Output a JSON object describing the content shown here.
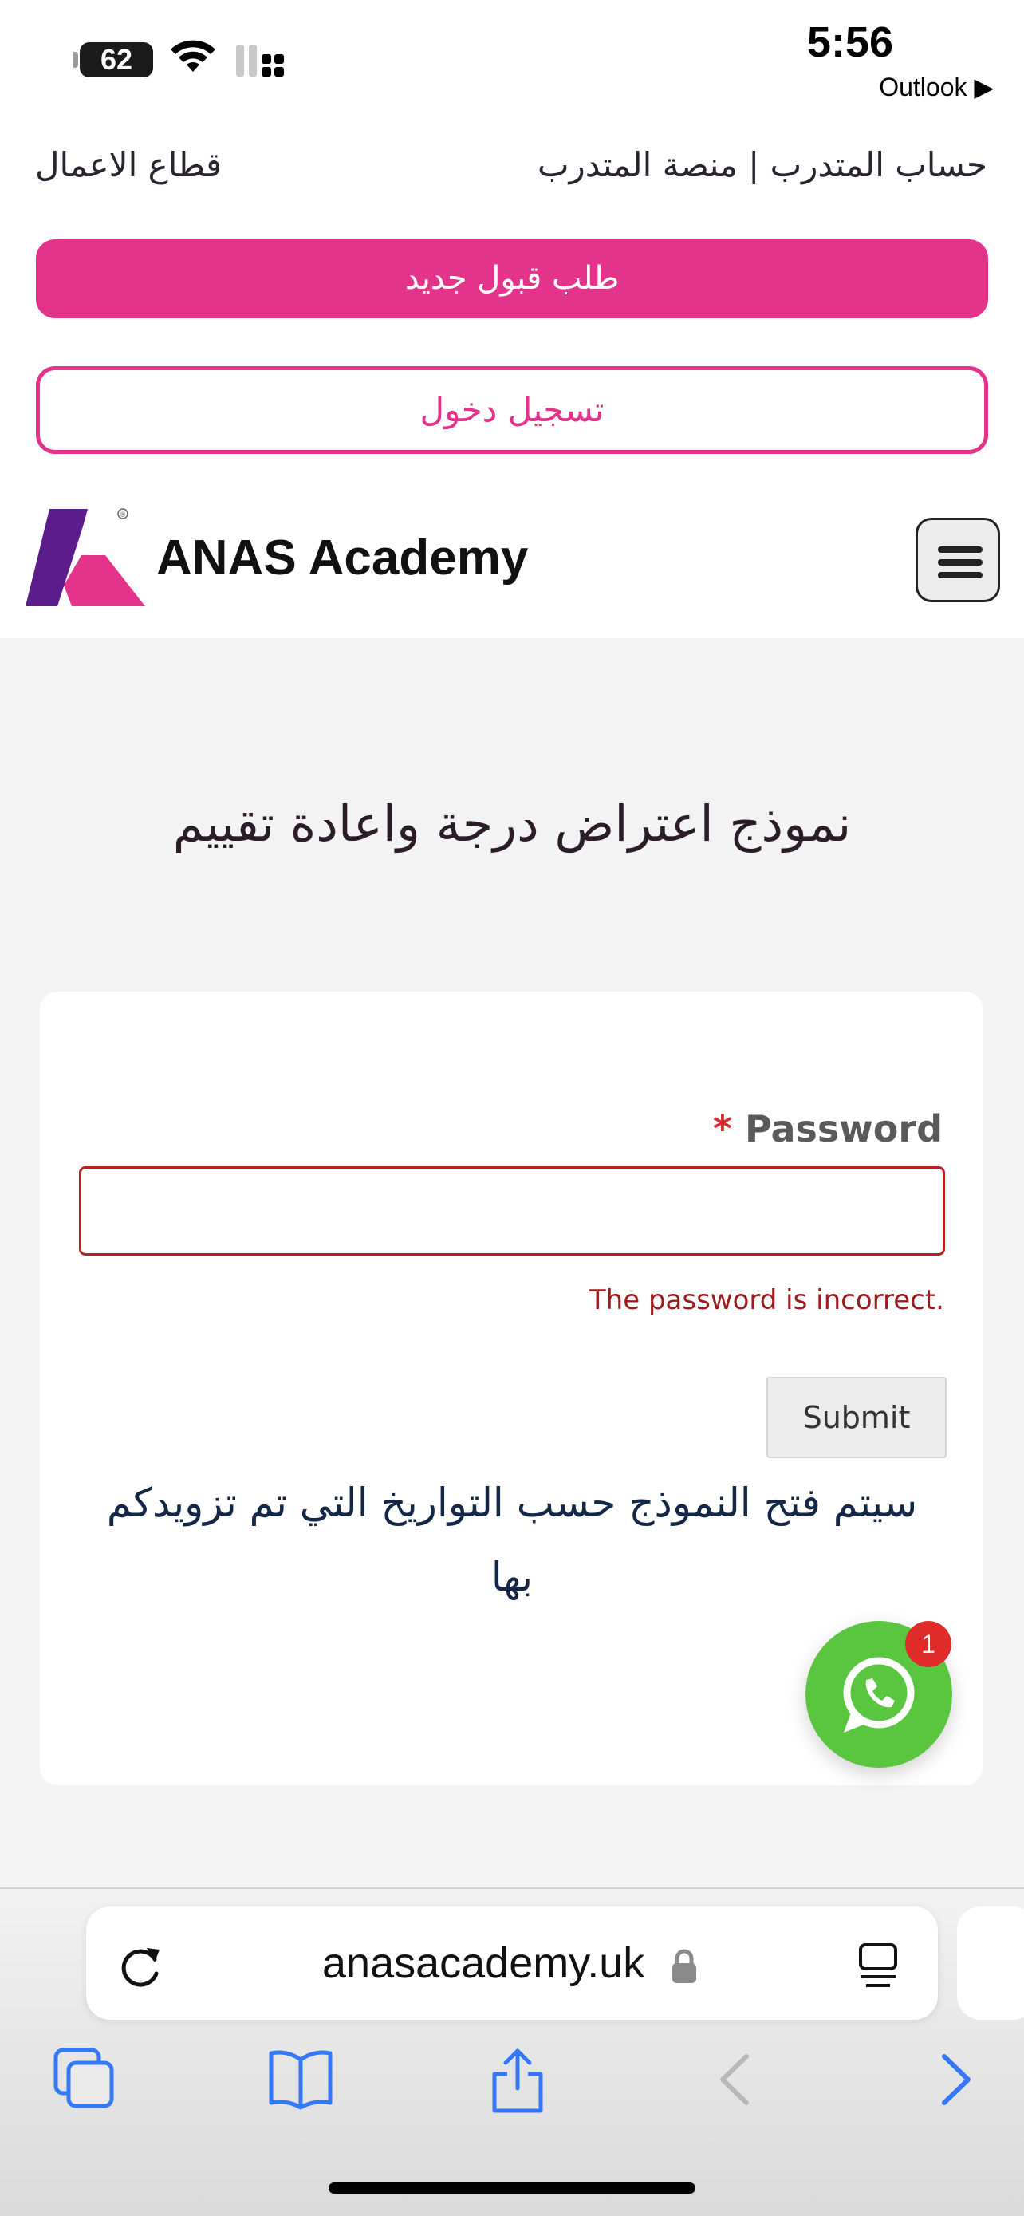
{
  "status": {
    "battery": "62",
    "time": "5:56",
    "back_app": "Outlook ▶"
  },
  "header": {
    "link_right": "حساب المتدرب | منصة المتدرب",
    "link_left": "قطاع الاعمال",
    "primary_button": "طلب قبول جديد",
    "outline_button": "تسجيل دخول",
    "brand": "ANAS Academy",
    "logo_registered": "®"
  },
  "main": {
    "title": "نموذج اعتراض درجة واعادة تقييم",
    "form": {
      "required_mark": "*",
      "password_label": "Password",
      "password_value": "",
      "error": "The password is incorrect.",
      "submit_label": "Submit"
    },
    "notice": "سيتم فتح النموذج حسب التواريخ التي تم تزويدكم بها",
    "whatsapp_badge": "1"
  },
  "browser": {
    "url": "anasacademy.uk",
    "accent_color": "#3478f6"
  },
  "colors": {
    "brand_pink": "#e3338a",
    "brand_purple": "#5b1c8c",
    "error_red": "#9b1c1c",
    "whatsapp_green": "#5ac640"
  }
}
